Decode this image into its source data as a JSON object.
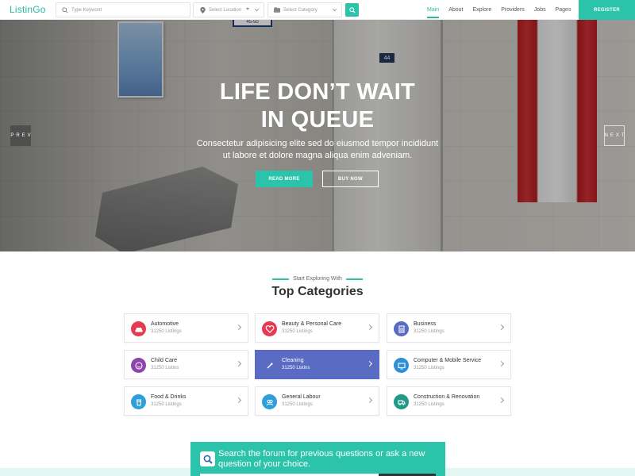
{
  "header": {
    "logo": "ListinGo",
    "keyword_placeholder": "Type Keyword",
    "location_placeholder": "Select Location",
    "category_placeholder": "Select Category",
    "nav": [
      "Main",
      "About",
      "Explore",
      "Providers",
      "Jobs",
      "Pages"
    ],
    "active_nav": "Main",
    "register_label": "REGISTER"
  },
  "hero": {
    "title_line1": "LIFE DON’T WAIT",
    "title_line2": "IN QUEUE",
    "subtitle_line1": "Consectetur adipisicing elite sed do eiusmod tempor incididunt",
    "subtitle_line2": "ut labore et dolore magna aliqua enim adveniam.",
    "read_more": "READ MORE",
    "buy_now": "BUY NOW",
    "prev": "PREV",
    "next": "NEXT",
    "door_number": "44",
    "sign_text": "45-50"
  },
  "categories": {
    "kicker": "Start Exploring With",
    "title": "Top Categories",
    "items": [
      {
        "name": "Automotive",
        "count": "31250 Listings",
        "color": "#e53b51",
        "icon": "car-icon"
      },
      {
        "name": "Beauty & Personal Care",
        "count": "31250 Listings",
        "color": "#e53b51",
        "icon": "heart-icon"
      },
      {
        "name": "Business",
        "count": "31250 Listings",
        "color": "#5a6bc4",
        "icon": "building-icon"
      },
      {
        "name": "Child Care",
        "count": "31250 Listins",
        "color": "#8e44ad",
        "icon": "smile-icon"
      },
      {
        "name": "Cleaning",
        "count": "31250 Listins",
        "color": "#5a6bc4",
        "icon": "brush-icon",
        "active": true
      },
      {
        "name": "Computer & Mobile Service",
        "count": "31250 Listings",
        "color": "#2e8fd8",
        "icon": "monitor-icon"
      },
      {
        "name": "Food & Drinks",
        "count": "31250 Listings",
        "color": "#2e9fd8",
        "icon": "cup-icon"
      },
      {
        "name": "General Labour",
        "count": "31250 Listings",
        "color": "#2e9fd8",
        "icon": "people-icon"
      },
      {
        "name": "Construction & Renovation",
        "count": "31250 Listings",
        "color": "#1f9a87",
        "icon": "truck-icon"
      }
    ]
  },
  "forum": {
    "text_line1": "Search the forum for previous questions or ask a new",
    "text_line2": "question of your choice."
  },
  "colors": {
    "accent": "#2bc4ab",
    "active_category": "#5a6bc4"
  }
}
